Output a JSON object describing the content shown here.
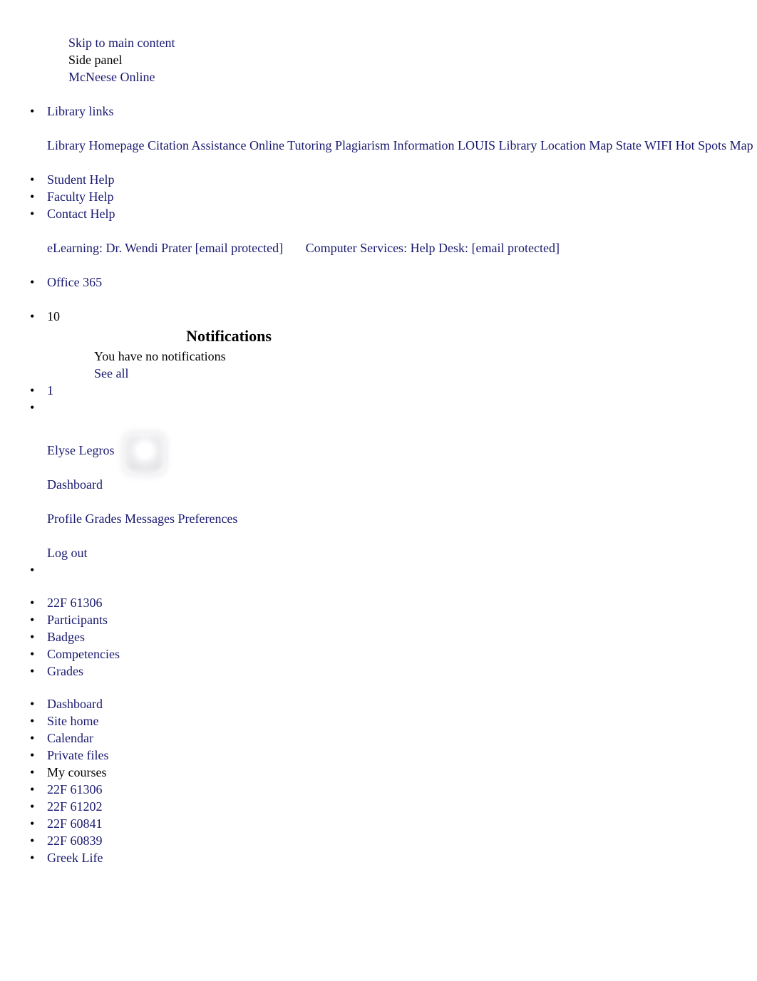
{
  "page": {
    "title": "McNeese Online",
    "link_color": "#191970",
    "text_color": "#000000",
    "background": "#ffffff"
  },
  "top": {
    "skip_link": "Skip to main content",
    "side_panel": "Side panel",
    "site_name": "McNeese Online"
  },
  "library": {
    "heading": "Library links",
    "links": [
      "Library Homepage",
      "Citation Assistance",
      "Online Tutoring",
      "Plagiarism Information",
      "LOUIS Library",
      "Location Map",
      "State WIFI Hot Spots Map"
    ]
  },
  "help": {
    "items": [
      "Student Help",
      "Faculty Help",
      "Contact Help"
    ],
    "contact_left_label": "eLearning: Dr. Wendi Prater",
    "contact_left_email": "[email protected]",
    "contact_right_label": "Computer Services: Help Desk:",
    "contact_right_email": "[email protected]"
  },
  "office": {
    "label": "Office 365"
  },
  "notifications": {
    "count_badge": "10",
    "title": "Notifications",
    "empty_text": "You have no notifications",
    "see_all": "See all"
  },
  "messages": {
    "count_badge": "1"
  },
  "user": {
    "name": "Elyse Legros",
    "dashboard": "Dashboard",
    "menu": [
      "Profile",
      "Grades",
      "Messages",
      "Preferences"
    ],
    "logout": "Log out"
  },
  "course_nav": {
    "items": [
      "22F 61306",
      "Participants",
      "Badges",
      "Competencies",
      "Grades"
    ]
  },
  "site_nav": {
    "items": [
      {
        "label": "Dashboard",
        "is_link": true
      },
      {
        "label": "Site home",
        "is_link": true
      },
      {
        "label": "Calendar",
        "is_link": true
      },
      {
        "label": "Private files",
        "is_link": true
      },
      {
        "label": "My courses",
        "is_link": false
      },
      {
        "label": "22F 61306",
        "is_link": true
      },
      {
        "label": "22F 61202",
        "is_link": true
      },
      {
        "label": "22F 60841",
        "is_link": true
      },
      {
        "label": "22F 60839",
        "is_link": true
      },
      {
        "label": "Greek Life",
        "is_link": true
      }
    ]
  }
}
